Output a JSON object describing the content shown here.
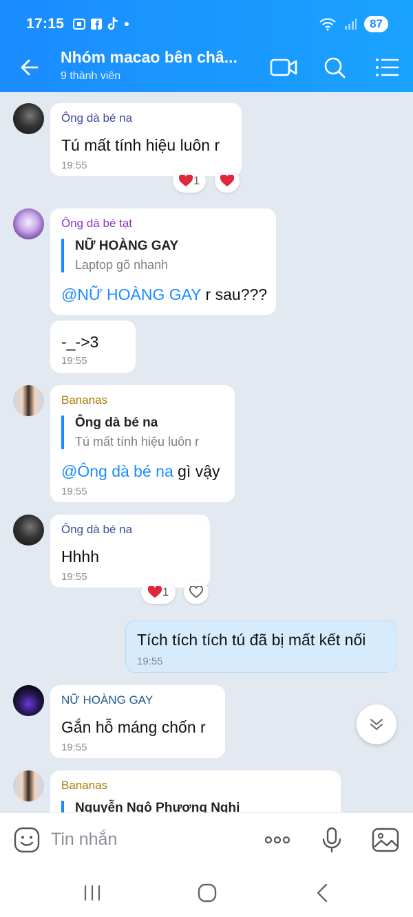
{
  "status": {
    "time": "17:15",
    "battery": "87"
  },
  "header": {
    "title": "Nhóm macao bên châ...",
    "subtitle": "9 thành viên"
  },
  "messages": [
    {
      "sender": "Ông dà bé na",
      "text": "Tú mất tính hiệu luôn r",
      "time": "19:55",
      "reaction_count": "1"
    },
    {
      "sender": "Ông dà bé tạt",
      "quote_name": "NỮ HOÀNG GAY",
      "quote_text": "Laptop gõ nhanh",
      "mention": "@NỮ HOÀNG GAY",
      "text": " r sau???"
    },
    {
      "text": "-_->3",
      "time": "19:55"
    },
    {
      "sender": "Bananas",
      "quote_name": "Ông dà bé na",
      "quote_text": "Tú mất tính hiệu luôn r",
      "mention": "@Ông dà bé na",
      "text": " gì vậy",
      "time": "19:55"
    },
    {
      "sender": "Ông dà bé na",
      "text": "Hhhh",
      "time": "19:55",
      "reaction_count": "1"
    },
    {
      "text": "Tích tích tích tú đã bị mất kết nối",
      "time": "19:55"
    },
    {
      "sender": "NỮ HOÀNG GAY",
      "text": "Gắn hỗ máng chốn r",
      "time": "19:55"
    },
    {
      "sender": "Bananas",
      "quote_name": "Nguyễn Ngô Phương Nghi"
    }
  ],
  "input": {
    "placeholder": "Tin nhắn"
  },
  "colors": {
    "accent": "#1a8cff",
    "sender_blue": "#3a4a9a",
    "sender_purple": "#8b2fc9",
    "sender_gold": "#a67c00",
    "sender_teal": "#1f5a8a"
  }
}
